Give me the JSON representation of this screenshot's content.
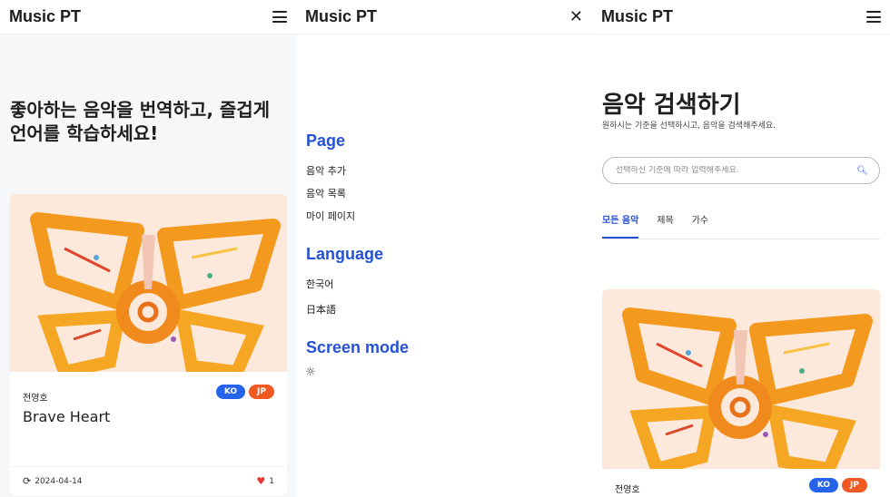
{
  "app": {
    "logo": "Music PT"
  },
  "home": {
    "hero_text": "좋아하는 음악을 번역하고, 즐겁게 언어를 학습하세요!",
    "card": {
      "artist": "전영호",
      "title": "Brave Heart",
      "badges": [
        "KO",
        "JP"
      ],
      "date": "2024-04-14",
      "likes": "1"
    }
  },
  "menu": {
    "sections": {
      "page": {
        "title": "Page",
        "items": [
          "음악 추가",
          "음악 목록",
          "마이 페이지"
        ]
      },
      "language": {
        "title": "Language",
        "items": [
          "한국어",
          "日本語"
        ]
      },
      "screen_mode": {
        "title": "Screen mode",
        "icon": "sun-icon"
      }
    }
  },
  "search": {
    "title": "음악 검색하기",
    "subtitle": "원하시는 기준을 선택하시고, 음악을 검색해주세요.",
    "placeholder": "선택하신 기준에 따라 입력해주세요.",
    "tabs": [
      "모든 음악",
      "제목",
      "가수"
    ],
    "active_tab": "모든 음악",
    "card": {
      "artist": "전영호",
      "badges": [
        "KO",
        "JP"
      ]
    }
  },
  "colors": {
    "accent": "#2451d6",
    "ko_badge": "#2563eb",
    "jp_badge": "#f05a22",
    "art_bg": "#fde9db"
  }
}
